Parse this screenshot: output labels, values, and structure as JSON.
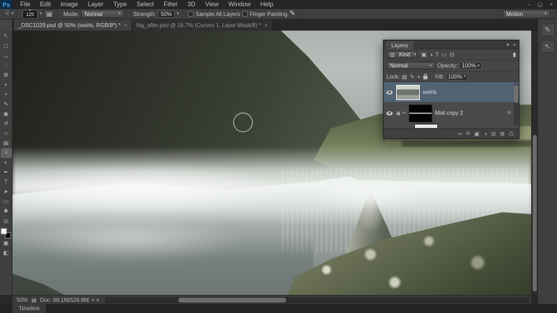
{
  "menu_bar": {
    "logo": "Ps",
    "items": [
      "File",
      "Edit",
      "Image",
      "Layer",
      "Type",
      "Select",
      "Filter",
      "3D",
      "View",
      "Window",
      "Help"
    ]
  },
  "window_controls": {
    "minimize": "–",
    "restore": "◱",
    "close": "×"
  },
  "options_bar": {
    "brush_size": "125",
    "mode_label": "Mode:",
    "mode_value": "Normal",
    "strength_label": "Strength:",
    "strength_value": "50%",
    "sample_all_layers_label": "Sample All Layers",
    "finger_painting_label": "Finger Painting",
    "workspace_value": "Motion"
  },
  "tabs": [
    {
      "title": "_DSC1029.psd @ 50% (swirls, RGB/8*) *"
    },
    {
      "title": "fog_after.psd @ 16.7% (Curves 1, Layer Mask/8) *"
    }
  ],
  "tools": {
    "items": [
      {
        "name": "move-tool",
        "glyph": "↖"
      },
      {
        "name": "marquee-tool",
        "glyph": "◻"
      },
      {
        "name": "lasso-tool",
        "glyph": "◡"
      },
      {
        "name": "quick-selection-tool",
        "glyph": "◌"
      },
      {
        "name": "crop-tool",
        "glyph": "⊞"
      },
      {
        "name": "eyedropper-tool",
        "glyph": "◗"
      },
      {
        "name": "healing-brush-tool",
        "glyph": "+"
      },
      {
        "name": "brush-tool",
        "glyph": "✎"
      },
      {
        "name": "clone-stamp-tool",
        "glyph": "◉"
      },
      {
        "name": "history-brush-tool",
        "glyph": "↺"
      },
      {
        "name": "eraser-tool",
        "glyph": "▱"
      },
      {
        "name": "gradient-tool",
        "glyph": "▤"
      },
      {
        "name": "smudge-tool",
        "glyph": "☟"
      },
      {
        "name": "dodge-tool",
        "glyph": "◐"
      },
      {
        "name": "pen-tool",
        "glyph": "✒"
      },
      {
        "name": "type-tool",
        "glyph": "T"
      },
      {
        "name": "path-selection-tool",
        "glyph": "➤"
      },
      {
        "name": "shape-tool",
        "glyph": "▭"
      },
      {
        "name": "hand-tool",
        "glyph": "✱"
      },
      {
        "name": "zoom-tool",
        "glyph": "◎"
      }
    ],
    "quick_mask_glyph": "▣",
    "screen_mode_glyph": "◧"
  },
  "icons": {
    "smudge": "☟",
    "caret": "▾",
    "dot": "•",
    "brush_panel_toggle": "▤",
    "pressure": "✎",
    "tab_close": "×",
    "panel_collapse": "▾",
    "panel_menu": "≡",
    "kind_picker": "◎",
    "filter_pixel": "▣",
    "filter_adjust": "◑",
    "filter_type": "T",
    "filter_shape": "▭",
    "filter_smart": "⊡",
    "filter_toggle": "▮",
    "lock_transparent": "▨",
    "lock_brush": "✎",
    "lock_move": "+",
    "clip": "▣",
    "chain": "∞",
    "link": "∞",
    "mask": "▣",
    "adjust": "◑",
    "group": "⊟",
    "new_layer": "⊞",
    "trash": "♺",
    "status_doc": "▤",
    "arrow_right": "▸",
    "arrow_left": "◂",
    "dock_brush": "✎",
    "dock_arrow": "↖"
  },
  "layers_panel": {
    "title": "Layers",
    "kind_label": "Kind",
    "blend_mode": "Normal",
    "opacity_label": "Opacity:",
    "opacity_value": "100%",
    "lock_label": "Lock:",
    "fill_label": "Fill:",
    "fill_value": "100%",
    "fx_badge": "fx",
    "layers": [
      {
        "name": "swirls",
        "selected": true
      },
      {
        "name": "Mist copy 2",
        "selected": false
      }
    ]
  },
  "status_bar": {
    "zoom": "50%",
    "doc_info": "Doc: 69.1M/526.8M"
  },
  "timeline": {
    "tab_label": "Timeline"
  },
  "colors": {
    "selected_layer_highlight": "#516273",
    "ps_logo_blue": "#4da3e8",
    "chrome_dark": "#262626",
    "panel_gray": "#454545"
  }
}
